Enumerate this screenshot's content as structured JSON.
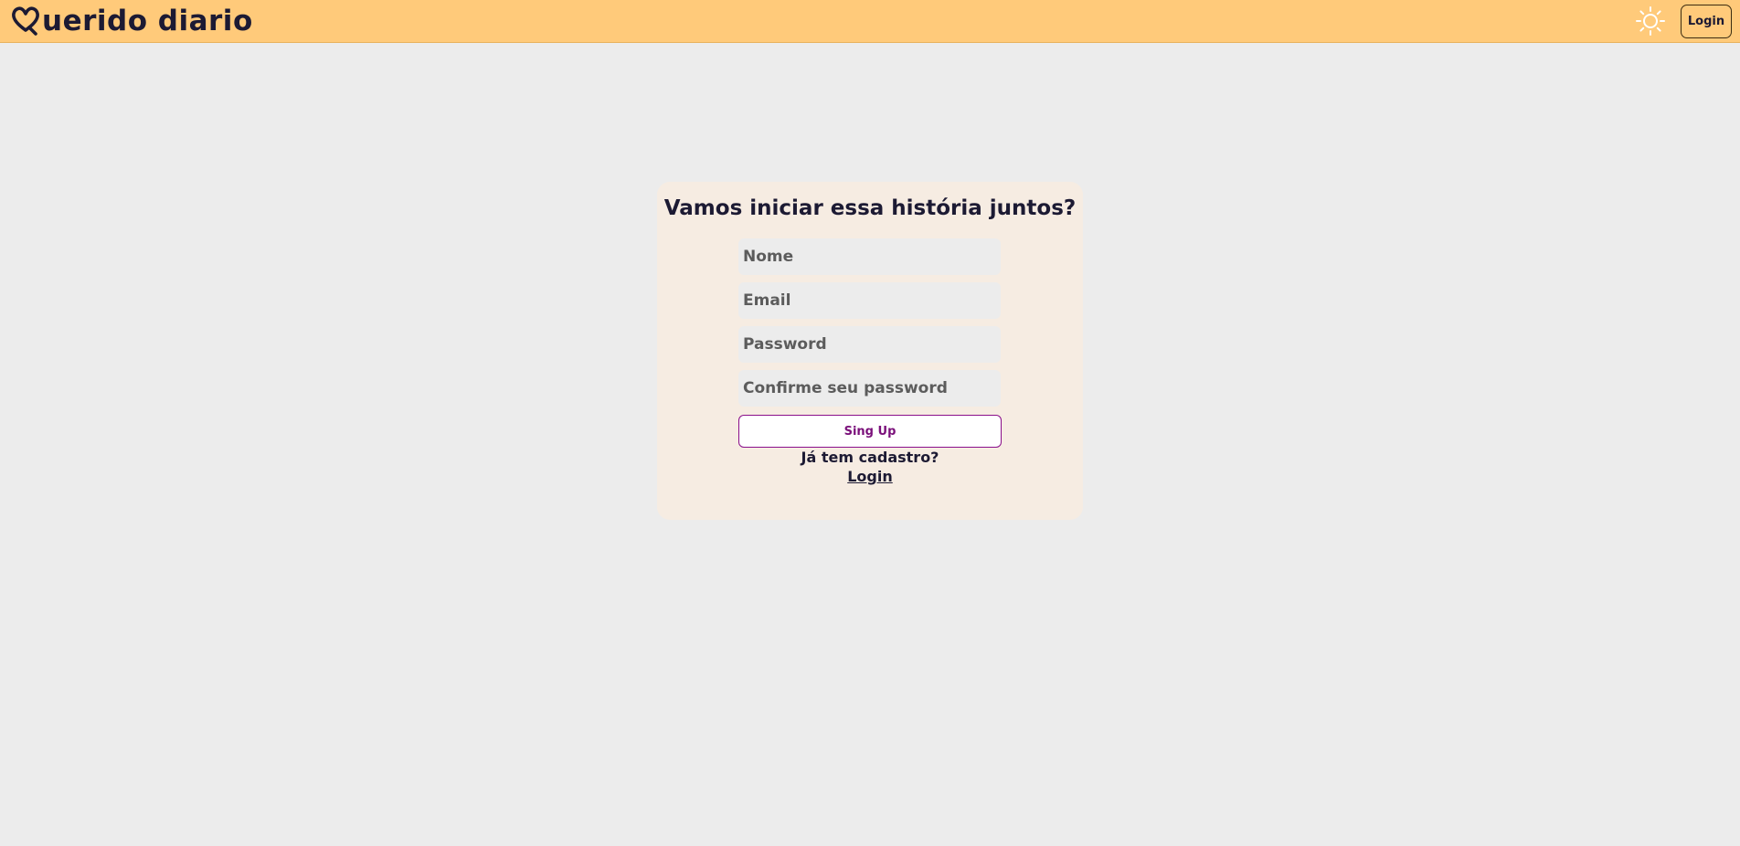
{
  "header": {
    "brand_text": "uerido diario",
    "brand_icon": "heart-q-icon",
    "theme_icon": "sun-icon",
    "login_label": "Login",
    "colors": {
      "bar": "#ffca7a",
      "text": "#1c1a33"
    }
  },
  "signup_card": {
    "title": "Vamos iniciar essa história juntos?",
    "fields": {
      "name_placeholder": "Nome",
      "email_placeholder": "Email",
      "password_placeholder": "Password",
      "confirm_placeholder": "Confirme seu password"
    },
    "submit_label": "Sing Up",
    "has_account_text": "Já tem cadastro?",
    "login_link_label": "Login",
    "colors": {
      "card": "#f6ece2",
      "accent": "#8a0f8a"
    }
  }
}
